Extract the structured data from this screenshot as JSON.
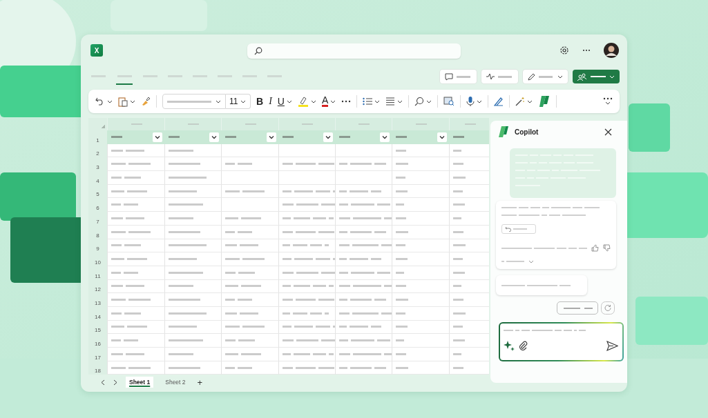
{
  "app": {
    "logo_letter": "X"
  },
  "tabs": [
    {
      "selected": false
    },
    {
      "selected": true
    },
    {
      "selected": false
    },
    {
      "selected": false
    },
    {
      "selected": false
    },
    {
      "selected": false
    },
    {
      "selected": false
    },
    {
      "selected": false
    }
  ],
  "ribbon": {
    "font_size": "11",
    "bold": "B",
    "italic": "I",
    "underline": "U",
    "font_color": "A"
  },
  "sheet": {
    "row_numbers": [
      "1",
      "2",
      "3",
      "4",
      "5",
      "6",
      "7",
      "8",
      "9",
      "10",
      "11",
      "12",
      "13",
      "14",
      "15",
      "16",
      "17",
      "18"
    ]
  },
  "copilot": {
    "title": "Copilot"
  },
  "sheet_tabs": [
    {
      "label": "Sheet 1",
      "selected": true
    },
    {
      "label": "Sheet 2",
      "selected": false
    }
  ],
  "add_sheet": "+"
}
